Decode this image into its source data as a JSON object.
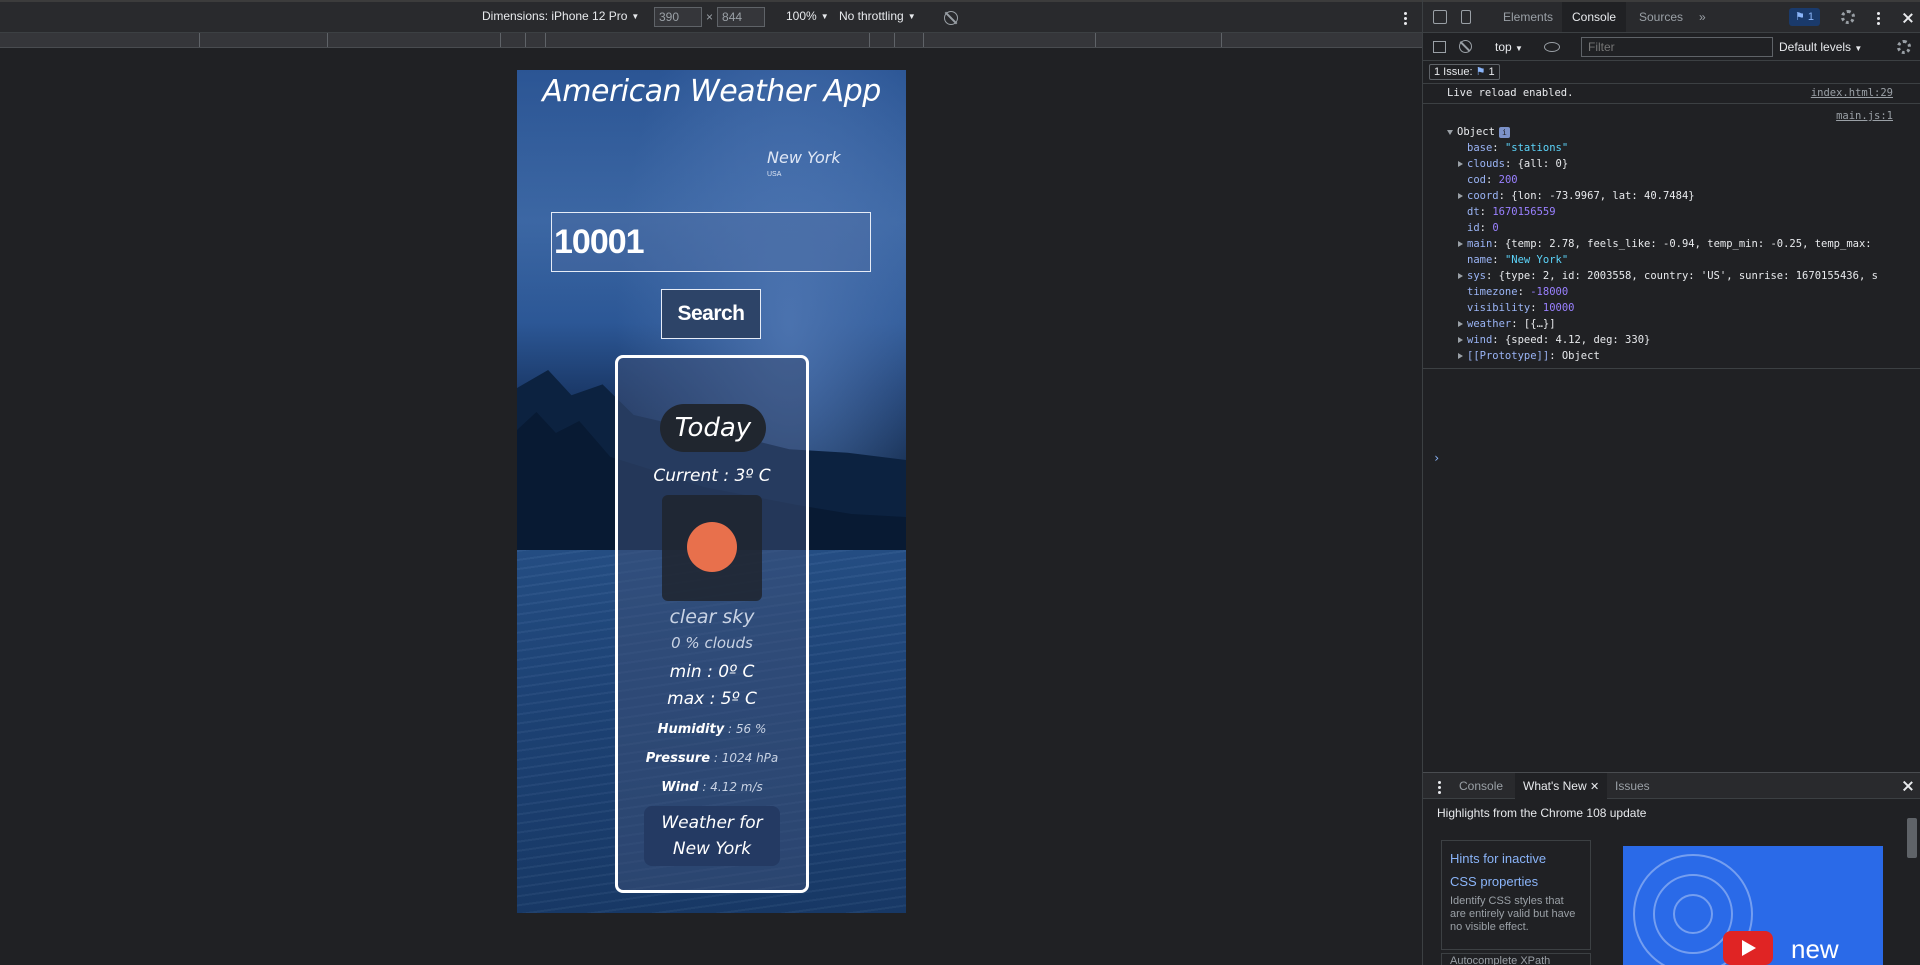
{
  "device_toolbar": {
    "dimensions_label": "Dimensions: iPhone 12 Pro",
    "width_value": "390",
    "times": "×",
    "height_value": "844",
    "zoom": "100%",
    "throttling": "No throttling"
  },
  "app": {
    "title": "American Weather App",
    "city": "New York",
    "country": "USA",
    "zip_value": "10001",
    "search_label": "Search",
    "today_label": "Today",
    "current_temp": "Current : 3º C",
    "description": "clear sky",
    "clouds": "0 % clouds",
    "min": "min : 0º C",
    "max": "max : 5º C",
    "humidity_label": "Humidity",
    "humidity_value": " : 56 %",
    "pressure_label": "Pressure",
    "pressure_value": " : 1024 hPa",
    "wind_label": "Wind",
    "wind_value": " : 4.12 m/s",
    "city_button_line1": "Weather for",
    "city_button_line2": "New York",
    "icon_color": "#e8704c"
  },
  "devtools": {
    "tabs": [
      "Elements",
      "Console",
      "Sources",
      "»"
    ],
    "active_tab": "Console",
    "issues_badge": "1",
    "context": "top",
    "filter_placeholder": "Filter",
    "levels": "Default levels",
    "issue_bar_label": "1 Issue:",
    "issue_bar_count": "1",
    "log": {
      "message": "Live reload enabled.",
      "source": "index.html:29",
      "object_source": "main.js:1",
      "object_label": "Object",
      "props": [
        {
          "key": "base",
          "value": "\"stations\"",
          "type": "s",
          "expandable": false
        },
        {
          "key": "clouds",
          "value": "{all: 0}",
          "type": "kw",
          "expandable": true
        },
        {
          "key": "cod",
          "value": "200",
          "type": "n",
          "expandable": false
        },
        {
          "key": "coord",
          "value": "{lon: -73.9967, lat: 40.7484}",
          "type": "kw",
          "expandable": true
        },
        {
          "key": "dt",
          "value": "1670156559",
          "type": "n",
          "expandable": false
        },
        {
          "key": "id",
          "value": "0",
          "type": "n",
          "expandable": false
        },
        {
          "key": "main",
          "value": "{temp: 2.78, feels_like: -0.94, temp_min: -0.25, temp_max:",
          "type": "kw",
          "expandable": true
        },
        {
          "key": "name",
          "value": "\"New York\"",
          "type": "s",
          "expandable": false
        },
        {
          "key": "sys",
          "value": "{type: 2, id: 2003558, country: 'US', sunrise: 1670155436, s",
          "type": "kw",
          "expandable": true
        },
        {
          "key": "timezone",
          "value": "-18000",
          "type": "n",
          "expandable": false
        },
        {
          "key": "visibility",
          "value": "10000",
          "type": "n",
          "expandable": false
        },
        {
          "key": "weather",
          "value": "[{…}]",
          "type": "kw",
          "expandable": true
        },
        {
          "key": "wind",
          "value": "{speed: 4.12, deg: 330}",
          "type": "kw",
          "expandable": true
        },
        {
          "key": "[[Prototype]]",
          "value": "Object",
          "type": "kw",
          "expandable": true
        }
      ],
      "prompt": "›"
    },
    "drawer": {
      "tabs": [
        "Console",
        "What's New",
        "Issues"
      ],
      "active": "What's New",
      "highlights": "Highlights from the Chrome 108 update",
      "card_title_1": "Hints for inactive",
      "card_title_2": "CSS properties",
      "card_desc": "Identify CSS styles that are entirely valid but have no visible effect.",
      "card2_text": "Autocomplete XPath",
      "promo_text": "new"
    }
  }
}
